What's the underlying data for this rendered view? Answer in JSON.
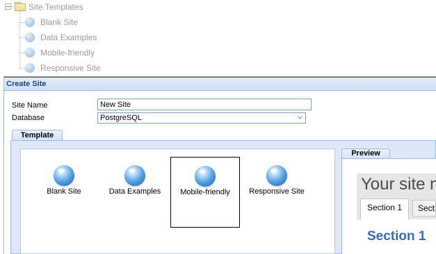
{
  "tree": {
    "root_label": "Site Templates",
    "items": [
      {
        "label": "Blank Site"
      },
      {
        "label": "Data Examples"
      },
      {
        "label": "Mobile-friendly"
      },
      {
        "label": "Responsive Site"
      }
    ]
  },
  "dialog": {
    "title": "Create Site",
    "site_name_label": "Site Name",
    "site_name_value": "New Site",
    "database_label": "Database",
    "database_value": "PostgreSQL",
    "template_tab": "Template",
    "templates": [
      {
        "label": "Blank Site",
        "icon": "globe-icon"
      },
      {
        "label": "Data Examples",
        "icon": "globe-icon"
      },
      {
        "label": "Mobile-friendly",
        "icon": "globe-icon",
        "selected": true
      },
      {
        "label": "Responsive Site",
        "icon": "globe-icon"
      }
    ],
    "preview_tab": "Preview",
    "preview": {
      "title": "Your site n",
      "tab1": "Section 1",
      "tab2": "Sect",
      "section_heading": "Section 1"
    }
  }
}
